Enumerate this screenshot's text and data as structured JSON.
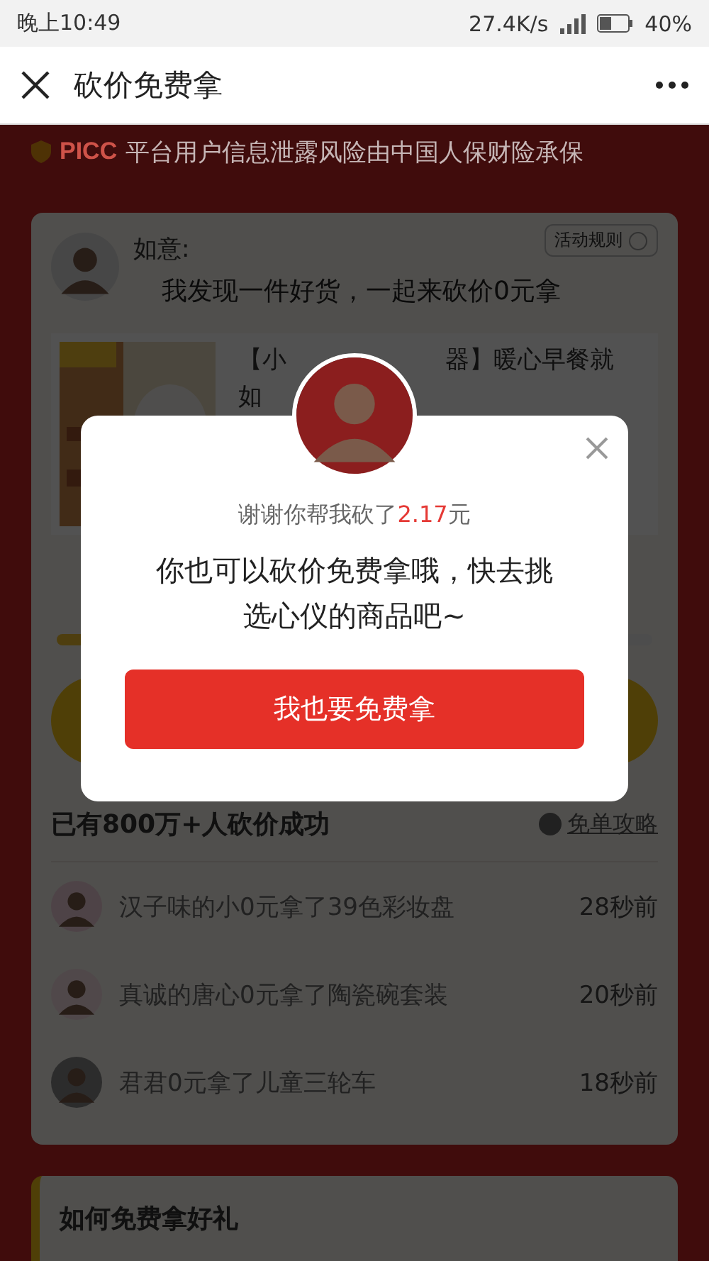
{
  "status_bar": {
    "time": "晚上10:49",
    "speed": "27.4K/s",
    "battery": "40%"
  },
  "nav": {
    "title": "砍价免费拿"
  },
  "banner": {
    "logo": "PICC",
    "text": "平台用户信息泄露风险由中国人保财险承保"
  },
  "inviter": {
    "name": "如意:",
    "message": "我发现一件好货，一起来砍价0元拿",
    "rules_button": "活动规则"
  },
  "product": {
    "title_parts": [
      "【小",
      "器】暖心早餐就",
      "如"
    ]
  },
  "stats": {
    "title": "已有800万+人砍价成功",
    "guide_link": "免单攻略",
    "records": [
      {
        "text": "汉子味的小0元拿了39色彩妆盘",
        "time": "28秒前"
      },
      {
        "text": "真诚的唐心0元拿了陶瓷碗套装",
        "time": "20秒前"
      },
      {
        "text": "君君0元拿了儿童三轮车",
        "time": "18秒前"
      }
    ]
  },
  "section": {
    "title": "如何免费拿好礼"
  },
  "modal": {
    "thanks": "谢谢你帮我砍了",
    "amount": "2.17",
    "unit": "元",
    "message": "你也可以砍价免费拿哦，快去挑选心仪的商品吧~",
    "button": "我也要免费拿"
  }
}
